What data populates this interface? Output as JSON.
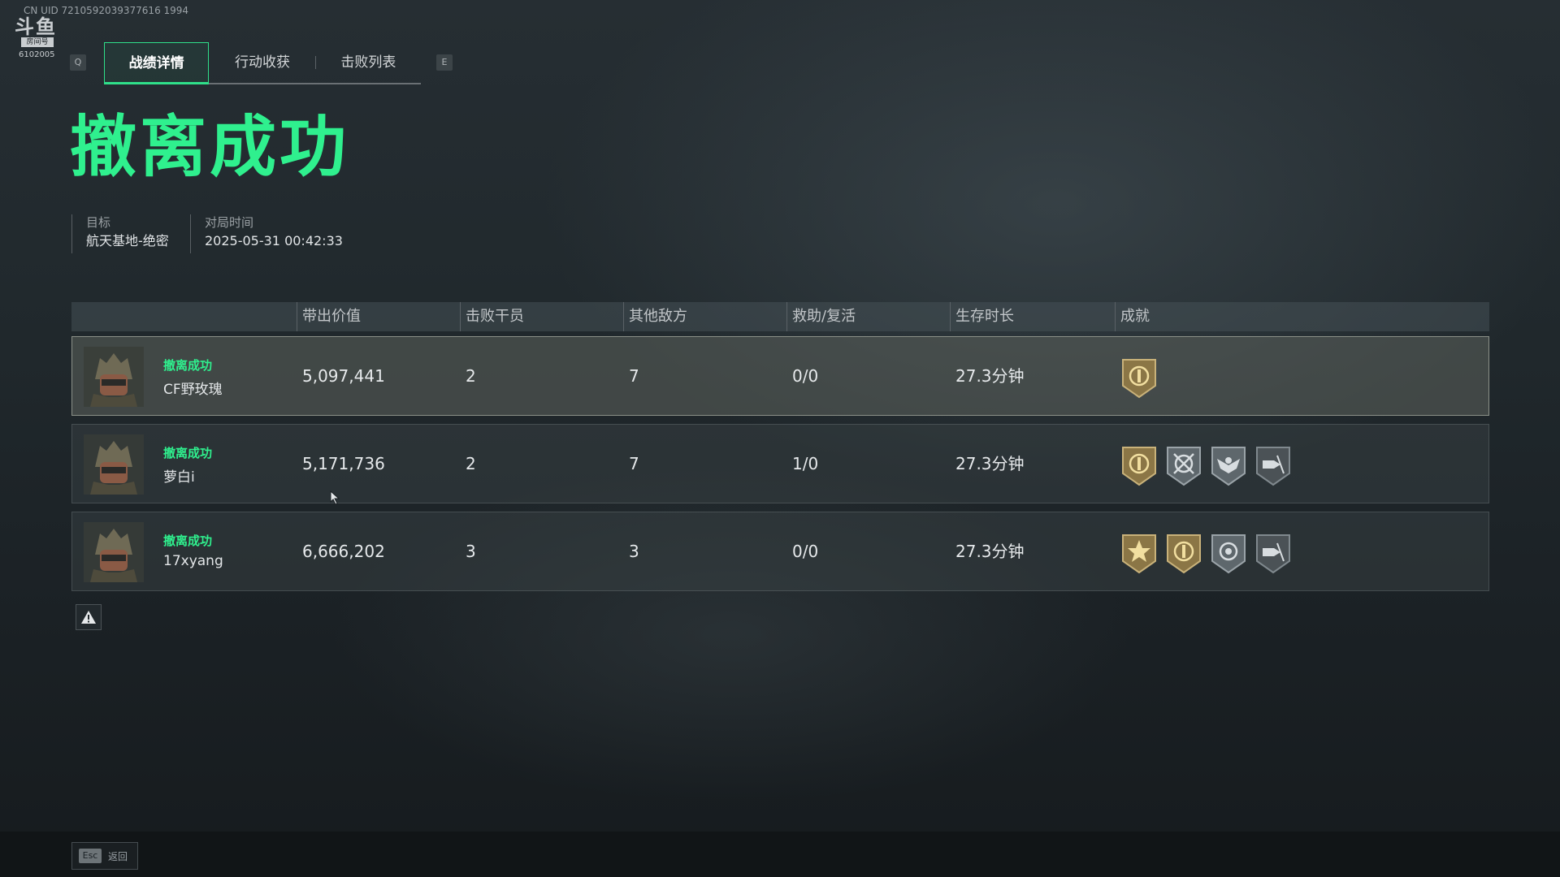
{
  "overlay": {
    "uid": "CN UID 7210592039377616 1994",
    "logo_mark": "斗鱼",
    "logo_tag": "房间号",
    "room_number": "6102005"
  },
  "tabs": {
    "prev_key": "Q",
    "next_key": "E",
    "items": [
      {
        "label": "战绩详情",
        "active": true
      },
      {
        "label": "行动收获",
        "active": false
      },
      {
        "label": "击败列表",
        "active": false
      }
    ]
  },
  "result": {
    "headline": "撤离成功",
    "target_label": "目标",
    "target_value": "航天基地-绝密",
    "time_label": "对局时间",
    "time_value": "2025-05-31 00:42:33"
  },
  "table": {
    "headers": {
      "value": "带出价值",
      "operators": "击败干员",
      "other_enemies": "其他敌方",
      "assist_revive": "救助/复活",
      "survival": "生存时长",
      "achievements": "成就"
    },
    "rows": [
      {
        "status": "撤离成功",
        "name": "CF野玫瑰",
        "value": "5,097,441",
        "operators": "2",
        "other_enemies": "7",
        "assist_revive": "0/0",
        "survival": "27.3分钟",
        "badges": [
          "gold-crest-badge-icon"
        ]
      },
      {
        "status": "撤离成功",
        "name": "萝白i",
        "value": "5,171,736",
        "operators": "2",
        "other_enemies": "7",
        "assist_revive": "1/0",
        "survival": "27.3分钟",
        "badges": [
          "gold-crest-badge-icon",
          "crosshair-badge-icon",
          "eagle-badge-icon",
          "bullet-badge-icon"
        ]
      },
      {
        "status": "撤离成功",
        "name": "17xyang",
        "value": "6,666,202",
        "operators": "3",
        "other_enemies": "3",
        "assist_revive": "0/0",
        "survival": "27.3分钟",
        "badges": [
          "gold-star-badge-icon",
          "gold-crest-badge-icon",
          "target-badge-icon",
          "bullet-badge-icon"
        ]
      }
    ]
  },
  "footer": {
    "esc_key": "Esc",
    "esc_label": "返回"
  },
  "colors": {
    "accent": "#2ff08e",
    "gold_badge": "#a8925a",
    "silver_badge": "#7e878c"
  }
}
